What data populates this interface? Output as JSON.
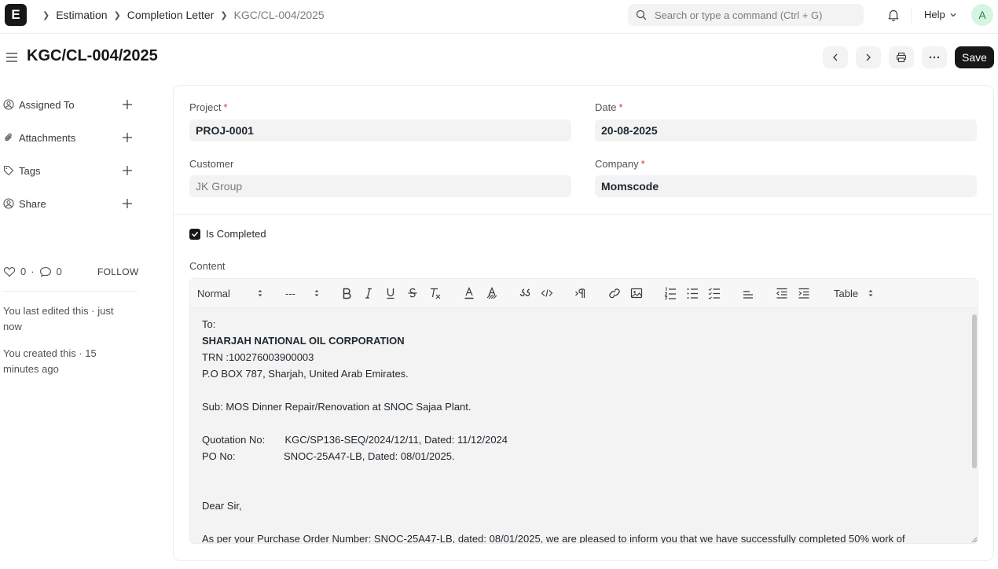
{
  "navbar": {
    "logo": "E",
    "breadcrumbs": [
      "Estimation",
      "Completion Letter",
      "KGC/CL-004/2025"
    ],
    "search_placeholder": "Search or type a command (Ctrl + G)",
    "help_label": "Help",
    "avatar_initial": "A"
  },
  "page": {
    "title": "KGC/CL-004/2025",
    "save_label": "Save"
  },
  "sidebar": {
    "items": [
      {
        "label": "Assigned To"
      },
      {
        "label": "Attachments"
      },
      {
        "label": "Tags"
      },
      {
        "label": "Share"
      }
    ],
    "likes": "0",
    "comments": "0",
    "follow_label": "FOLLOW",
    "activity": [
      "You last edited this · just now",
      "You created this · 15 minutes ago"
    ]
  },
  "form": {
    "project_label": "Project",
    "project_value": "PROJ-0001",
    "date_label": "Date",
    "date_value": "20-08-2025",
    "customer_label": "Customer",
    "customer_value": "JK Group",
    "company_label": "Company",
    "company_value": "Momscode",
    "required_mark": "*",
    "is_completed_label": "Is Completed",
    "is_completed": true,
    "content_label": "Content"
  },
  "editor": {
    "toolbar": {
      "heading_select": "Normal",
      "size_select": "---",
      "table_select": "Table"
    },
    "lines": [
      {
        "text": "To:",
        "bold": false
      },
      {
        "text": "SHARJAH NATIONAL OIL CORPORATION",
        "bold": true
      },
      {
        "text": "TRN :100276003900003",
        "bold": false
      },
      {
        "text": "P.O BOX 787, Sharjah, United Arab Emirates.",
        "bold": false
      },
      {
        "text": "",
        "bold": false
      },
      {
        "text": "Sub: MOS Dinner Repair/Renovation at SNOC Sajaa Plant.",
        "bold": false
      },
      {
        "text": "",
        "bold": false
      },
      {
        "text": "Quotation No:       KGC/SP136-SEQ/2024/12/11, Dated: 11/12/2024",
        "bold": false
      },
      {
        "text": "PO No:                 SNOC-25A47-LB, Dated: 08/01/2025.",
        "bold": false
      },
      {
        "text": "",
        "bold": false
      },
      {
        "text": "",
        "bold": false
      },
      {
        "text": "Dear Sir,",
        "bold": false
      },
      {
        "text": "",
        "bold": false
      },
      {
        "text": "As per your Purchase Order Number: SNOC-25A47-LB, dated: 08/01/2025, we are pleased to inform you that we have successfully completed 50% work of",
        "bold": false
      }
    ]
  }
}
